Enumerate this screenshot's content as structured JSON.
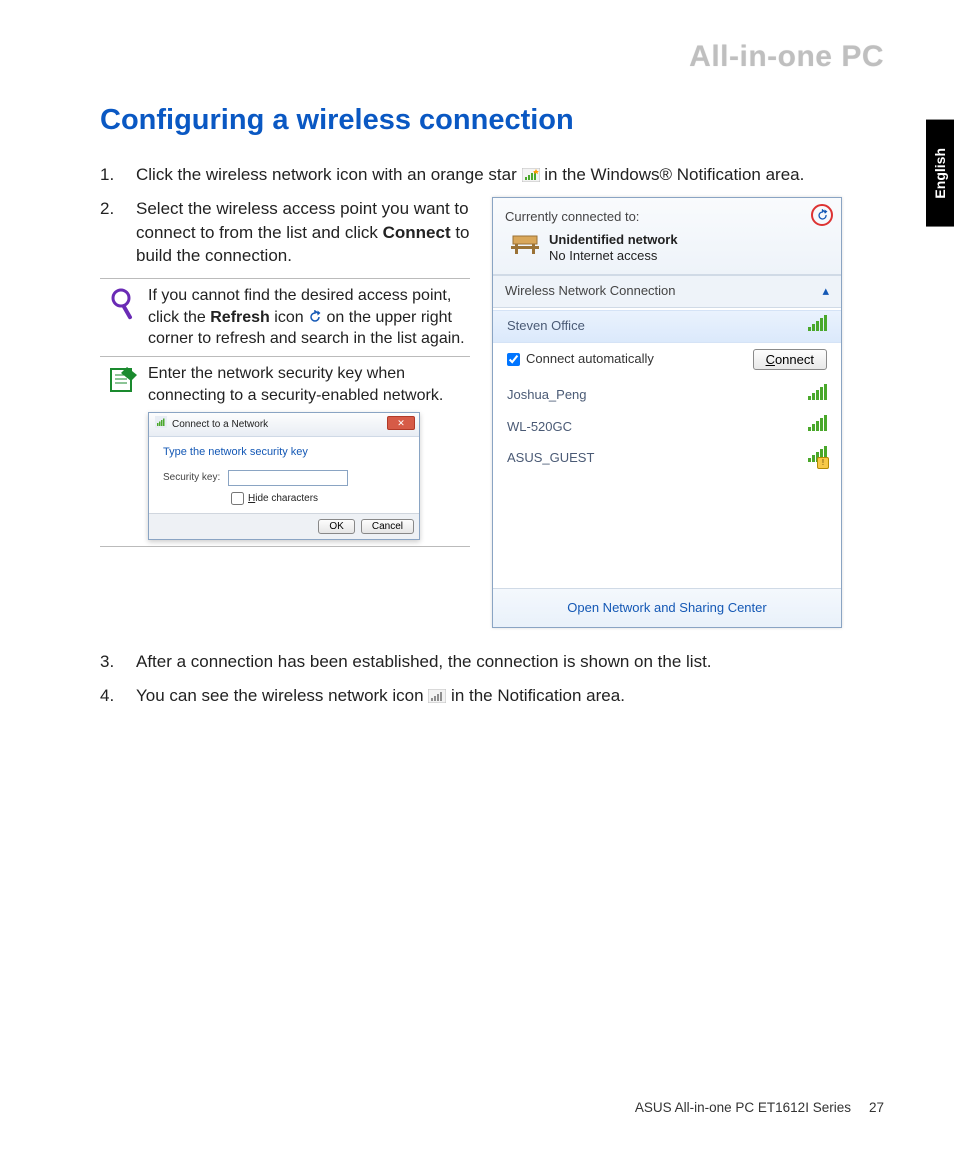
{
  "header": "All-in-one PC",
  "language_tab": "English",
  "title": "Configuring a wireless connection",
  "steps": {
    "s1": {
      "num": "1.",
      "pre": "Click the wireless network icon with an orange star ",
      "post": " in the Windows® Notification area."
    },
    "s2": {
      "num": "2.",
      "pre": "Select the wireless access point you want to connect to from the list and click ",
      "bold": "Connect",
      "post": " to build the connection."
    },
    "s3": {
      "num": "3.",
      "text": "After a connection has been established, the connection is shown on the list."
    },
    "s4": {
      "num": "4.",
      "pre": "You can see the wireless network icon ",
      "post": " in the Notification area."
    }
  },
  "note1": {
    "pre": "If you cannot find the desired access point, click the ",
    "bold": "Refresh",
    "mid": " icon ",
    "post": " on the upper right corner to refresh and search in the list again."
  },
  "note2": "Enter the network security key when connecting to a security-enabled network.",
  "sec_dialog": {
    "title": "Connect to a Network",
    "prompt": "Type the network security key",
    "key_label": "Security key:",
    "hide_label": "Hide characters",
    "ok": "OK",
    "cancel": "Cancel"
  },
  "flyout": {
    "connected_label": "Currently connected to:",
    "net_name": "Unidentified network",
    "net_status": "No Internet access",
    "section_label": "Wireless Network Connection",
    "auto_label": "Connect automatically",
    "connect_btn_pre": "C",
    "connect_btn_post": "onnect",
    "foot": "Open Network and Sharing Center",
    "items": [
      {
        "name": "Steven Office",
        "selected": true,
        "warn": false
      },
      {
        "name": "Joshua_Peng",
        "selected": false,
        "warn": false
      },
      {
        "name": "WL-520GC",
        "selected": false,
        "warn": false
      },
      {
        "name": "ASUS_GUEST",
        "selected": false,
        "warn": true
      }
    ]
  },
  "footer": {
    "model": "ASUS All-in-one PC  ET1612I Series",
    "page": "27"
  }
}
